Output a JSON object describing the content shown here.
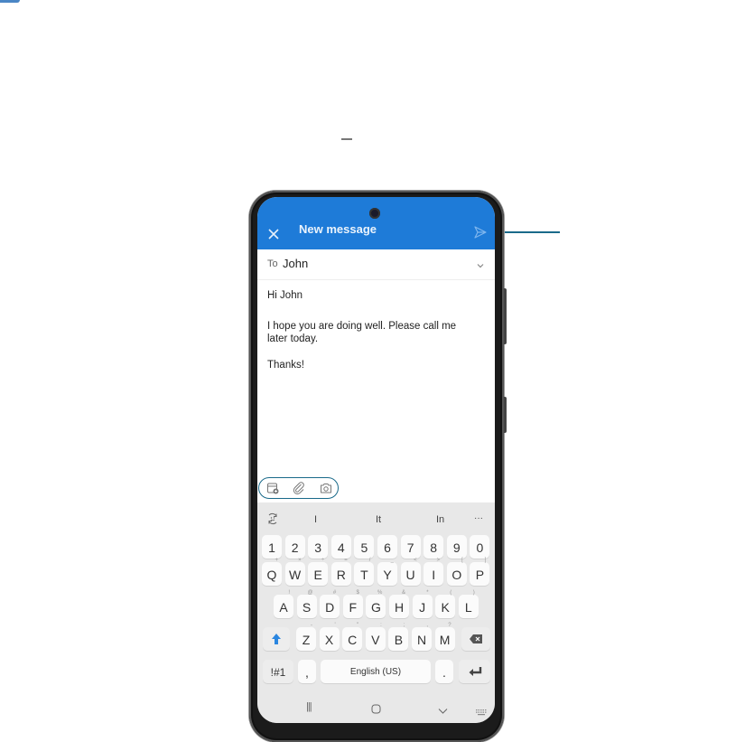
{
  "app": {
    "title": "New message",
    "colors": {
      "header": "#1e7bd8",
      "callout": "#1a6a8a",
      "keyboard_bg": "#e8e8e8"
    }
  },
  "header": {
    "close_icon": "close-icon",
    "title": "New message",
    "send_icon": "send-icon"
  },
  "to_row": {
    "label": "To",
    "value": "John",
    "chevron_icon": "chevron-down-icon"
  },
  "message": {
    "greeting": "Hi John",
    "line1": "I hope you are doing well. Please call me",
    "line2": "later today.",
    "signoff": "Thanks!"
  },
  "attach_toolbar": {
    "items": [
      {
        "icon": "calendar-add-icon"
      },
      {
        "icon": "paperclip-icon"
      },
      {
        "icon": "camera-icon"
      }
    ]
  },
  "keyboard": {
    "suggestions": [
      "I",
      "It",
      "In"
    ],
    "suggestion_toggle_icon": "keyboard-mode-icon",
    "more_label": "···",
    "number_row": [
      "1",
      "2",
      "3",
      "4",
      "5",
      "6",
      "7",
      "8",
      "9",
      "0"
    ],
    "row1": [
      {
        "k": "Q",
        "s": "+"
      },
      {
        "k": "W",
        "s": "×"
      },
      {
        "k": "E",
        "s": "÷"
      },
      {
        "k": "R",
        "s": "="
      },
      {
        "k": "T",
        "s": "/"
      },
      {
        "k": "Y",
        "s": "_"
      },
      {
        "k": "U",
        "s": "<"
      },
      {
        "k": "I",
        "s": ">"
      },
      {
        "k": "O",
        "s": "["
      },
      {
        "k": "P",
        "s": "]"
      }
    ],
    "row2": [
      {
        "k": "A",
        "s": "!"
      },
      {
        "k": "S",
        "s": "@"
      },
      {
        "k": "D",
        "s": "#"
      },
      {
        "k": "F",
        "s": "$"
      },
      {
        "k": "G",
        "s": "%"
      },
      {
        "k": "H",
        "s": "&"
      },
      {
        "k": "J",
        "s": "*"
      },
      {
        "k": "K",
        "s": "("
      },
      {
        "k": "L",
        "s": ")"
      }
    ],
    "row3": [
      {
        "k": "Z",
        "s": "-"
      },
      {
        "k": "X",
        "s": "'"
      },
      {
        "k": "C",
        "s": "\""
      },
      {
        "k": "V",
        "s": ":"
      },
      {
        "k": "B",
        "s": ";"
      },
      {
        "k": "N",
        "s": ","
      },
      {
        "k": "M",
        "s": "?"
      }
    ],
    "symbols_label": "!#1",
    "comma_label": ",",
    "space_label": "English (US)",
    "period_label": ".",
    "shift_icon": "shift-icon",
    "backspace_icon": "backspace-icon",
    "enter_icon": "enter-icon"
  },
  "nav_bar": {
    "recents_label": "|||",
    "home_icon": "home-icon",
    "back_icon": "chevron-down-icon",
    "keyboard_icon": "keyboard-icon"
  }
}
